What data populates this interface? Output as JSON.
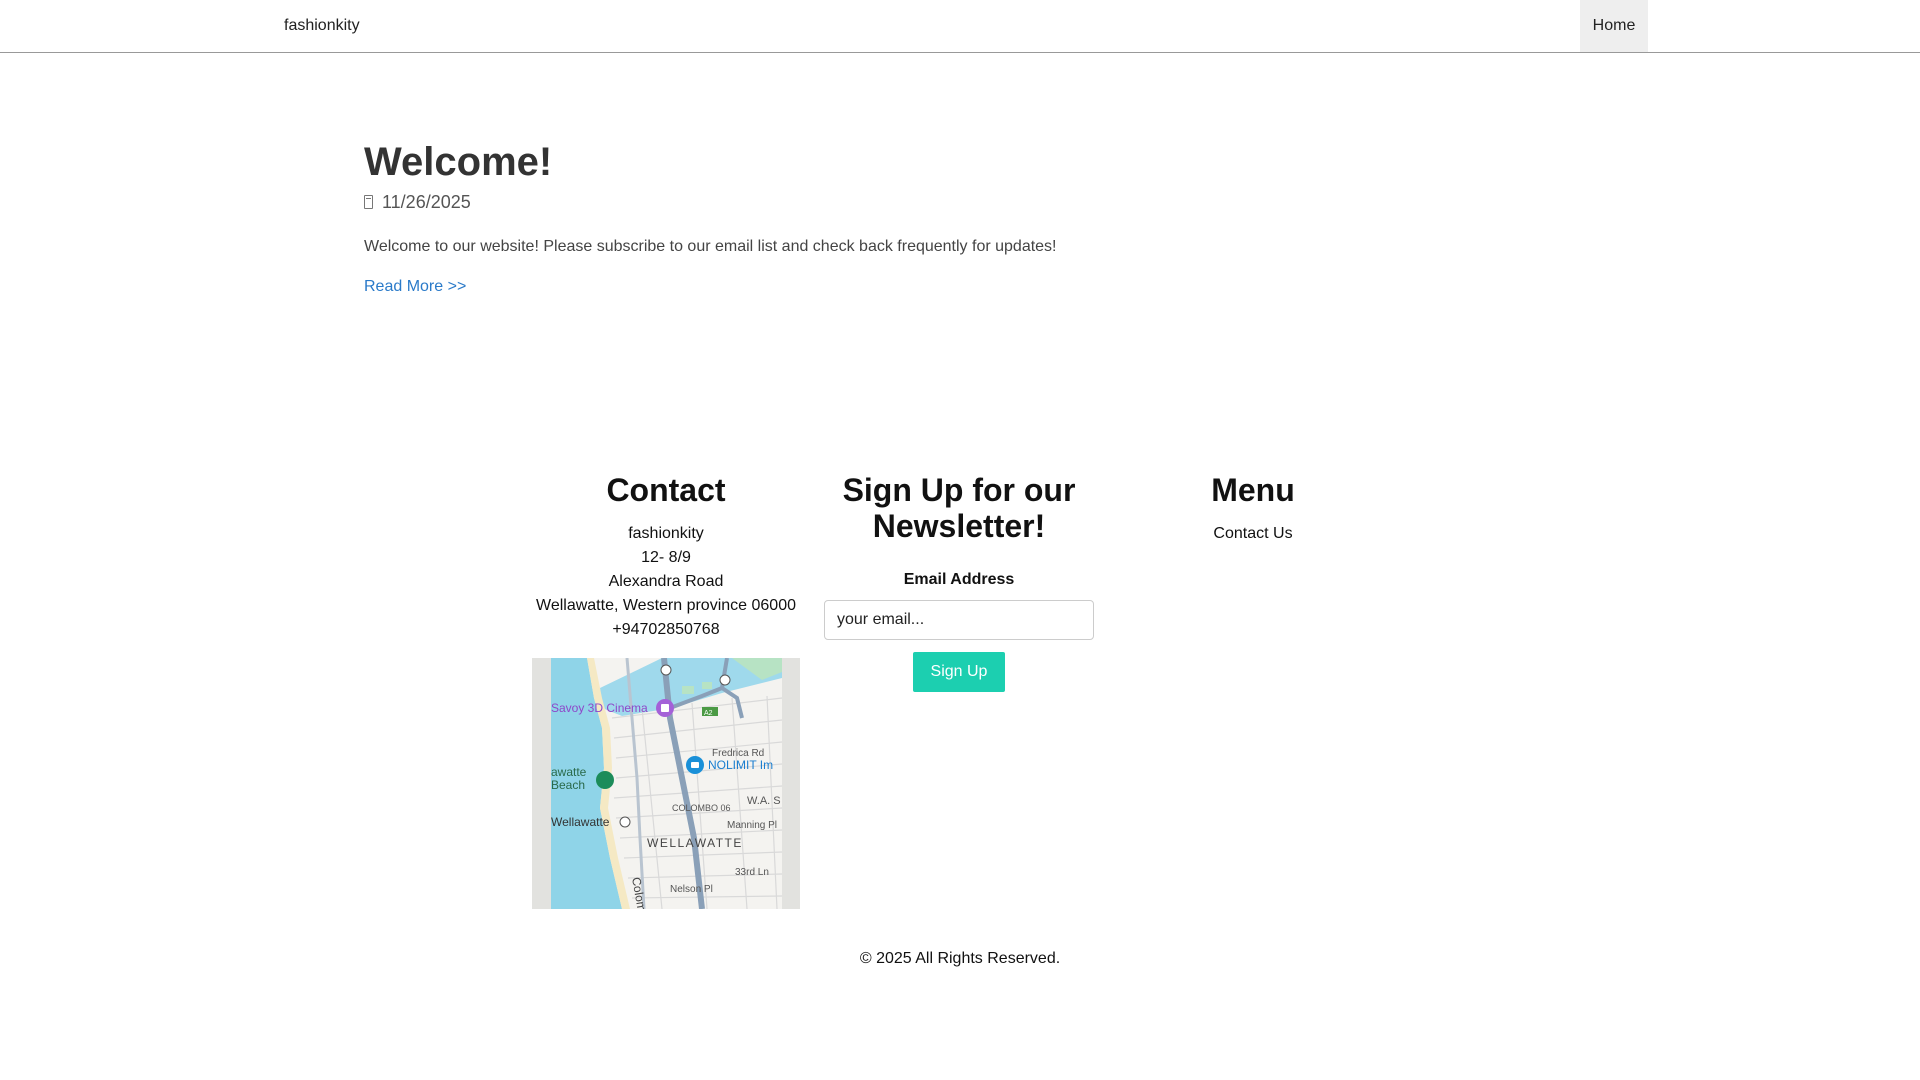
{
  "nav": {
    "brand": "fashionkity",
    "home": "Home"
  },
  "post": {
    "title": "Welcome!",
    "date": "11/26/2025",
    "body": "Welcome to our website! Please subscribe to our email list and check back frequently for updates!",
    "read_more": "Read More >>"
  },
  "contact": {
    "heading": "Contact",
    "lines": [
      "fashionkity",
      "12- 8/9",
      "Alexandra Road",
      "Wellawatte, Western province 06000",
      "+94702850768"
    ],
    "map_labels": {
      "cinema": "Savoy 3D Cinema",
      "road_a2": "A2",
      "fredrica": "Fredrica Rd",
      "nolimit": "NOLIMIT Im",
      "beach1": "awatte",
      "beach2": "Beach",
      "colombo": "COLOMBO 06",
      "was": "W.A. S",
      "wellawatte_station": "Wellawatte",
      "manning": "Manning Pl",
      "area": "WELLAWATTE",
      "ln33": "33rd Ln",
      "nelson": "Nelson Pl",
      "colom": "Colom"
    }
  },
  "newsletter": {
    "heading": "Sign Up for our Newsletter!",
    "label": "Email Address",
    "placeholder": "your email...",
    "button": "Sign Up"
  },
  "menu": {
    "heading": "Menu",
    "items": [
      "Contact Us"
    ]
  },
  "footer": {
    "copyright": "© 2025 All Rights Reserved."
  },
  "colors": {
    "accent": "#1ccfb0",
    "link": "#2a7ac9",
    "water": "#8fd4e8"
  },
  "icons": {
    "date": "calendar-icon"
  }
}
